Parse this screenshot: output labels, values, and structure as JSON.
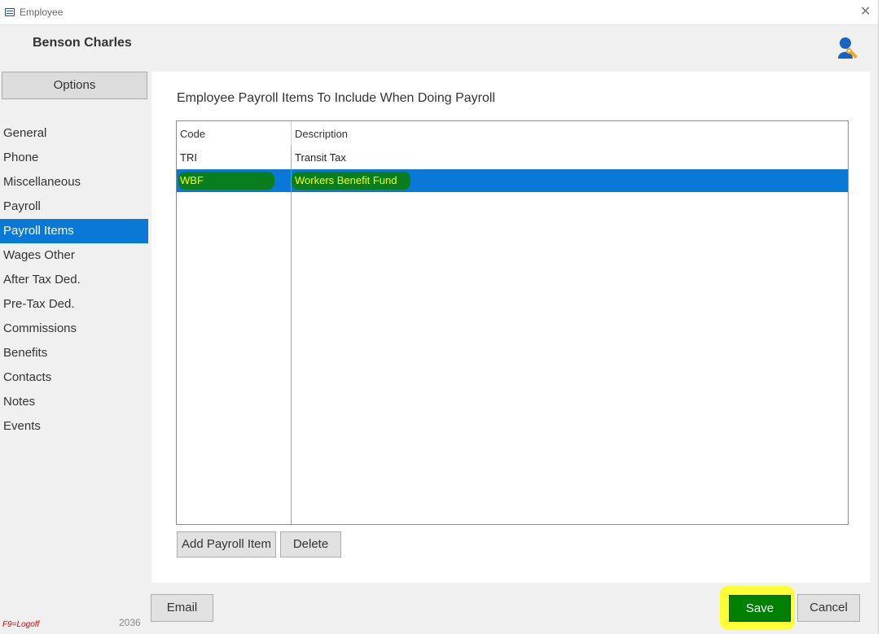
{
  "window": {
    "title": "Employee"
  },
  "header": {
    "employee_name": "Benson Charles",
    "icon": "person-wrench-icon"
  },
  "sidebar": {
    "options_label": "Options",
    "items": [
      {
        "label": "General"
      },
      {
        "label": "Phone"
      },
      {
        "label": "Miscellaneous"
      },
      {
        "label": "Payroll"
      },
      {
        "label": "Payroll Items",
        "active": true
      },
      {
        "label": "Wages Other"
      },
      {
        "label": "After Tax Ded."
      },
      {
        "label": "Pre-Tax Ded."
      },
      {
        "label": "Commissions"
      },
      {
        "label": "Benefits"
      },
      {
        "label": "Contacts"
      },
      {
        "label": "Notes"
      },
      {
        "label": "Events"
      }
    ]
  },
  "main": {
    "title": "Employee Payroll Items To Include When Doing Payroll",
    "table": {
      "columns": [
        "Code",
        "Description"
      ],
      "rows": [
        {
          "code": "TRI",
          "description": "Transit Tax",
          "selected": false
        },
        {
          "code": "WBF",
          "description": "Workers Benefit Fund",
          "selected": true
        }
      ]
    },
    "add_button": "Add Payroll Item",
    "delete_button": "Delete"
  },
  "footer": {
    "email_button": "Email",
    "save_button": "Save",
    "cancel_button": "Cancel",
    "logoff_hint": "F9=Logoff",
    "version": "2036"
  },
  "colors": {
    "accent": "#0a78d7",
    "save_green": "#008000",
    "highlight_yellow": "#ffff33",
    "marker_green": "#0a7e1c"
  }
}
